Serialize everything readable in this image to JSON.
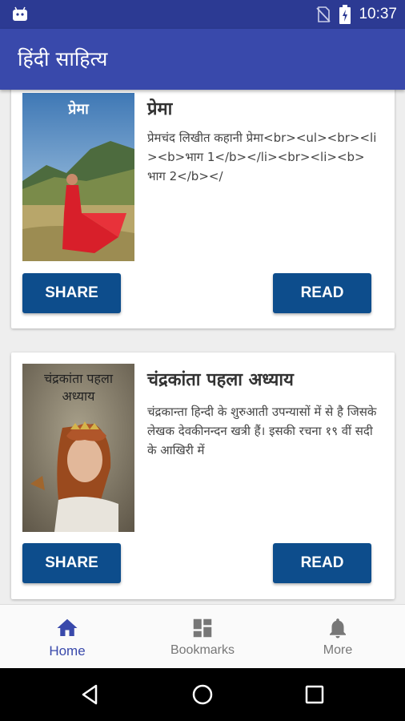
{
  "status_bar": {
    "time": "10:37",
    "icons": [
      "android-debug-icon",
      "no-sim-icon",
      "battery-charging-icon"
    ]
  },
  "app_bar": {
    "title": "हिंदी साहित्य"
  },
  "cards": [
    {
      "title": "प्रेमा",
      "cover_text": "प्रेमा",
      "description": "प्रेमचंद लिखीत कहानी प्रेमा<br><ul><br><li><b>भाग 1</b></li><br><li><b>भाग 2</b></",
      "share_label": "SHARE",
      "read_label": "READ"
    },
    {
      "title": "चंद्रकांता पहला अध्याय",
      "cover_text": "चंद्रकांता पहला अध्याय",
      "description": "चंद्रकान्ता हिन्दी के शुरुआती उपन्यासों में से है जिसके लेखक देवकीनन्दन खत्री हैं। इसकी रचना १९ वीं सदी के आखिरी में",
      "share_label": "SHARE",
      "read_label": "READ"
    }
  ],
  "bottom_nav": {
    "items": [
      {
        "label": "Home",
        "icon": "home-icon",
        "active": true
      },
      {
        "label": "Bookmarks",
        "icon": "dashboard-icon",
        "active": false
      },
      {
        "label": "More",
        "icon": "bell-icon",
        "active": false
      }
    ]
  },
  "colors": {
    "status_bar": "#2c3a93",
    "app_bar": "#3949ab",
    "button": "#0d4d8c",
    "nav_active": "#3949ab"
  }
}
